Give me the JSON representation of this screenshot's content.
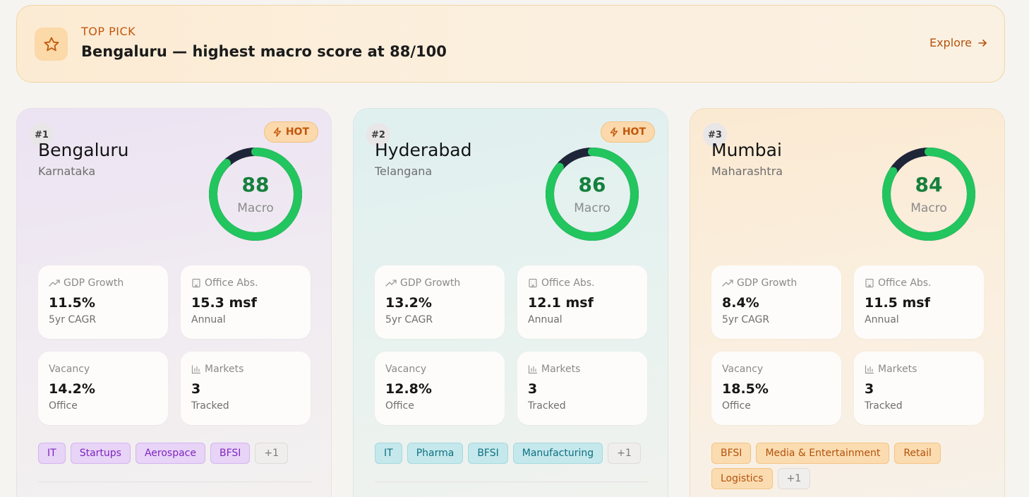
{
  "banner": {
    "eyebrow": "TOP PICK",
    "title": "Bengaluru — highest macro score at 88/100",
    "cta": "Explore",
    "icon": "star-icon",
    "accent": "#c2570c"
  },
  "cards": [
    {
      "rank": "#1",
      "city": "Bengaluru",
      "state": "Karnataka",
      "badge": "HOT",
      "score": "88",
      "score_value": 88,
      "score_label": "Macro",
      "metrics": [
        {
          "label": "GDP Growth",
          "value": "11.5%",
          "sub": "5yr CAGR",
          "icon": "trending-up-icon"
        },
        {
          "label": "Office Abs.",
          "value": "15.3 msf",
          "sub": "Annual",
          "icon": "building-icon"
        },
        {
          "label": "Vacancy",
          "value": "14.2%",
          "sub": "Office",
          "icon": ""
        },
        {
          "label": "Markets",
          "value": "3",
          "sub": "Tracked",
          "icon": "bar-chart-icon"
        }
      ],
      "tags": [
        "IT",
        "Startups",
        "Aerospace",
        "BFSI"
      ],
      "more": "+1"
    },
    {
      "rank": "#2",
      "city": "Hyderabad",
      "state": "Telangana",
      "badge": "HOT",
      "score": "86",
      "score_value": 86,
      "score_label": "Macro",
      "metrics": [
        {
          "label": "GDP Growth",
          "value": "13.2%",
          "sub": "5yr CAGR",
          "icon": "trending-up-icon"
        },
        {
          "label": "Office Abs.",
          "value": "12.1 msf",
          "sub": "Annual",
          "icon": "building-icon"
        },
        {
          "label": "Vacancy",
          "value": "12.8%",
          "sub": "Office",
          "icon": ""
        },
        {
          "label": "Markets",
          "value": "3",
          "sub": "Tracked",
          "icon": "bar-chart-icon"
        }
      ],
      "tags": [
        "IT",
        "Pharma",
        "BFSI",
        "Manufacturing"
      ],
      "more": "+1"
    },
    {
      "rank": "#3",
      "city": "Mumbai",
      "state": "Maharashtra",
      "badge": "",
      "score": "84",
      "score_value": 84,
      "score_label": "Macro",
      "metrics": [
        {
          "label": "GDP Growth",
          "value": "8.4%",
          "sub": "5yr CAGR",
          "icon": "trending-up-icon"
        },
        {
          "label": "Office Abs.",
          "value": "11.5 msf",
          "sub": "Annual",
          "icon": "building-icon"
        },
        {
          "label": "Vacancy",
          "value": "18.5%",
          "sub": "Office",
          "icon": ""
        },
        {
          "label": "Markets",
          "value": "3",
          "sub": "Tracked",
          "icon": "bar-chart-icon"
        }
      ],
      "tags": [
        "BFSI",
        "Media & Entertainment",
        "Retail",
        "Logistics"
      ],
      "more": "+1"
    }
  ],
  "colors": {
    "gauge_fill": "#22c55e",
    "gauge_track": "#1e2538",
    "score_text": "#15803d"
  }
}
